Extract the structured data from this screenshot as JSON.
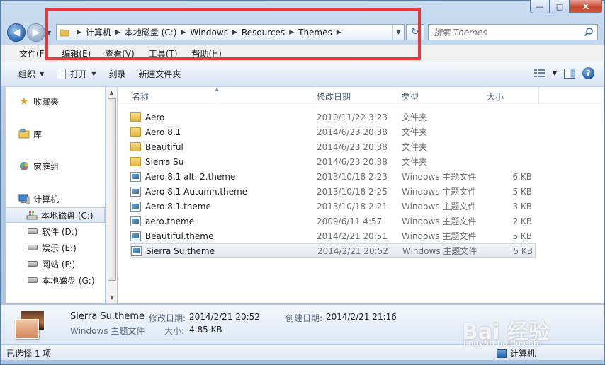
{
  "window": {
    "minimize": "—",
    "maximize": "□",
    "close": "X"
  },
  "address_bar": {
    "breadcrumbs": [
      "计算机",
      "本地磁盘 (C:)",
      "Windows",
      "Resources",
      "Themes"
    ]
  },
  "search": {
    "placeholder": "搜索 Themes"
  },
  "menubar": {
    "items": [
      "文件(F)",
      "编辑(E)",
      "查看(V)",
      "工具(T)",
      "帮助(H)"
    ]
  },
  "commandbar": {
    "organize": "组织",
    "open": "打开",
    "burn": "刻录",
    "new_folder": "新建文件夹"
  },
  "navpane": {
    "favorites": "收藏夹",
    "libraries": "库",
    "homegroup": "家庭组",
    "computer": "计算机",
    "drives": [
      "本地磁盘 (C:)",
      "软件 (D:)",
      "娱乐 (E:)",
      "网站 (F:)",
      "本地磁盘 (G:)"
    ]
  },
  "columns": {
    "name": "名称",
    "modified": "修改日期",
    "type": "类型",
    "size": "大小"
  },
  "files": [
    {
      "name": "Aero",
      "date": "2010/11/22 3:23",
      "type": "文件夹",
      "size": "",
      "kind": "folder"
    },
    {
      "name": "Aero 8.1",
      "date": "2014/6/23 20:38",
      "type": "文件夹",
      "size": "",
      "kind": "folder"
    },
    {
      "name": "Beautiful",
      "date": "2014/6/23 20:38",
      "type": "文件夹",
      "size": "",
      "kind": "folder"
    },
    {
      "name": "Sierra Su",
      "date": "2014/6/23 20:38",
      "type": "文件夹",
      "size": "",
      "kind": "folder"
    },
    {
      "name": "Aero 8.1 alt. 2.theme",
      "date": "2013/10/18 2:23",
      "type": "Windows 主题文件",
      "size": "6 KB",
      "kind": "theme"
    },
    {
      "name": "Aero 8.1 Autumn.theme",
      "date": "2013/10/18 2:25",
      "type": "Windows 主题文件",
      "size": "5 KB",
      "kind": "theme"
    },
    {
      "name": "Aero 8.1.theme",
      "date": "2013/10/18 2:21",
      "type": "Windows 主题文件",
      "size": "3 KB",
      "kind": "theme"
    },
    {
      "name": "aero.theme",
      "date": "2009/6/11 4:57",
      "type": "Windows 主题文件",
      "size": "2 KB",
      "kind": "theme"
    },
    {
      "name": "Beautiful.theme",
      "date": "2014/2/21 20:51",
      "type": "Windows 主题文件",
      "size": "5 KB",
      "kind": "theme"
    },
    {
      "name": "Sierra Su.theme",
      "date": "2014/2/21 20:52",
      "type": "Windows 主题文件",
      "size": "5 KB",
      "kind": "theme"
    }
  ],
  "details": {
    "filename": "Sierra Su.theme",
    "filetype": "Windows 主题文件",
    "modified_label": "修改日期:",
    "modified_value": "2014/2/21 20:52",
    "created_label": "创建日期:",
    "created_value": "2014/2/21 21:16",
    "size_label": "大小:",
    "size_value": "4.85 KB"
  },
  "status": {
    "selection": "已选择 1 项",
    "location": "计算机"
  },
  "watermark": {
    "text": "Bai 经验",
    "sub": "jingyan.baidu.com"
  }
}
